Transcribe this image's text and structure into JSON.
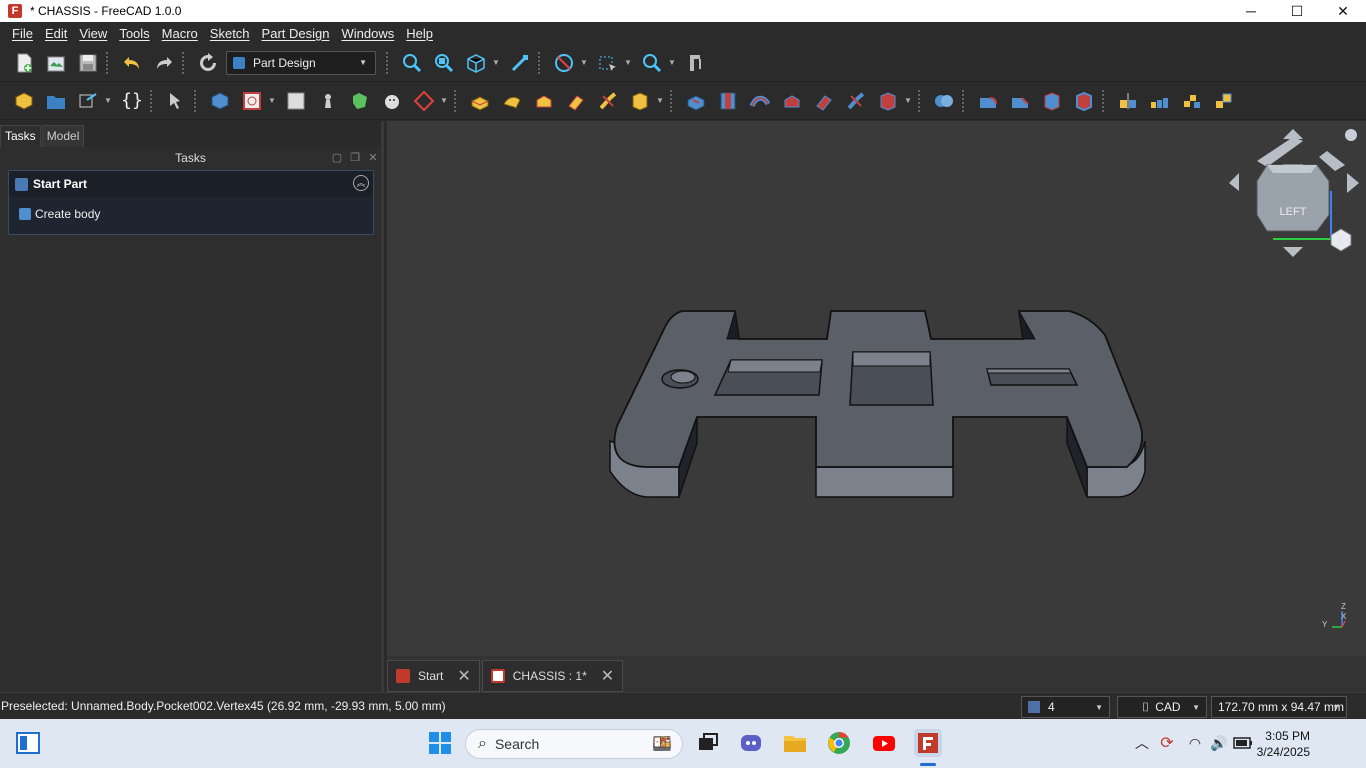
{
  "window": {
    "title": "* CHASSIS - FreeCAD 1.0.0",
    "minimize": "─",
    "maximize": "☐",
    "close": "✕"
  },
  "menu": [
    "File",
    "Edit",
    "View",
    "Tools",
    "Macro",
    "Sketch",
    "Part Design",
    "Windows",
    "Help"
  ],
  "workbench": {
    "selected": "Part Design"
  },
  "left_panel": {
    "tabs": [
      "Tasks",
      "Model"
    ],
    "active_tab": "Tasks",
    "header": "Tasks",
    "task_box": {
      "title": "Start Part",
      "item": "Create body"
    }
  },
  "viewport": {
    "navcube_face": "LEFT",
    "axis_labels": {
      "z": "Z",
      "x": "X",
      "y": "Y"
    }
  },
  "doc_tabs": [
    {
      "label": "Start",
      "icon": "freecad-logo-icon"
    },
    {
      "label": "CHASSIS : 1*",
      "icon": "document-icon"
    }
  ],
  "status": {
    "message": "Preselected: Unnamed.Body.Pocket002.Vertex45 (26.92 mm, -29.93 mm, 5.00 mm)",
    "draw_style": "4",
    "nav_style": "CAD",
    "dimensions": "172.70 mm x 94.47 mm"
  },
  "taskbar": {
    "search_placeholder": "Search",
    "time": "3:05 PM",
    "date": "3/24/2025"
  },
  "colors": {
    "accent": "#3b82c4",
    "part_fill": "#5a5f68",
    "viewport_bg": "#3a3a3a"
  }
}
